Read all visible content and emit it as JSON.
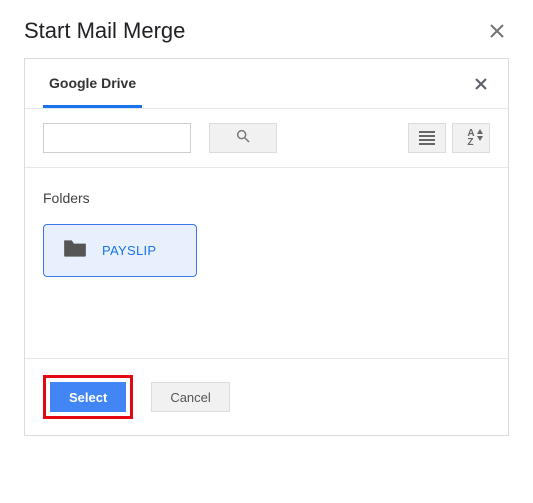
{
  "dialog": {
    "title": "Start Mail Merge"
  },
  "picker": {
    "tab_label": "Google Drive",
    "search_placeholder": "",
    "section_label": "Folders",
    "folders": [
      {
        "name": "PAYSLIP"
      }
    ],
    "buttons": {
      "select": "Select",
      "cancel": "Cancel"
    }
  },
  "colors": {
    "accent": "#1a73e8",
    "primary_button": "#4285f4",
    "highlight_border": "#e30613"
  }
}
